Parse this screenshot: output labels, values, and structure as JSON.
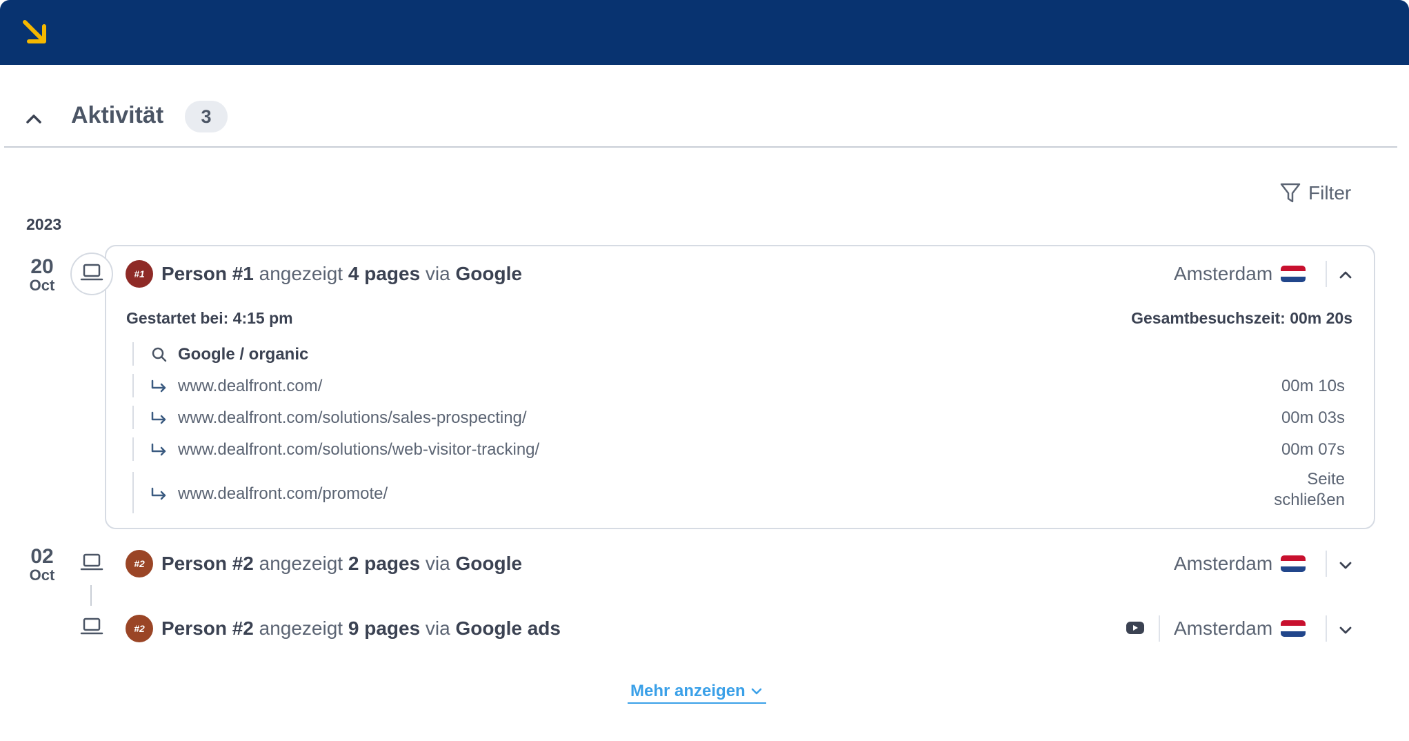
{
  "header": {
    "logo_icon": "arrow-down-right-icon",
    "brand_color": "#083370",
    "accent_color": "#f5b800"
  },
  "section": {
    "title": "Aktivität",
    "count": "3"
  },
  "filter": {
    "label": "Filter"
  },
  "year": "2023",
  "session1": {
    "date_day": "20",
    "date_month": "Oct",
    "badge": "#1",
    "person": "Person #1",
    "verb": "angezeigt",
    "pages": "4 pages",
    "via": "via",
    "source": "Google",
    "location": "Amsterdam",
    "started_label": "Gestartet bei: 4:15 pm",
    "total_label": "Gesamtbesuchszeit: 00m 20s",
    "referrer": "Google / organic",
    "visits": [
      {
        "url": "www.dealfront.com/",
        "duration": "00m 10s"
      },
      {
        "url": "www.dealfront.com/solutions/sales-prospecting/",
        "duration": "00m 03s"
      },
      {
        "url": "www.dealfront.com/solutions/web-visitor-tracking/",
        "duration": "00m 07s"
      },
      {
        "url": "www.dealfront.com/promote/",
        "duration_line1": "Seite",
        "duration_line2": "schließen"
      }
    ]
  },
  "session2": {
    "date_day": "02",
    "date_month": "Oct",
    "badge": "#2",
    "person": "Person #2",
    "verb": "angezeigt",
    "pages": "2 pages",
    "via": "via",
    "source": "Google",
    "location": "Amsterdam"
  },
  "session3": {
    "badge": "#2",
    "person": "Person #2",
    "verb": "angezeigt",
    "pages": "9 pages",
    "via": "via",
    "source": "Google ads",
    "location": "Amsterdam"
  },
  "more": {
    "label": "Mehr anzeigen"
  }
}
